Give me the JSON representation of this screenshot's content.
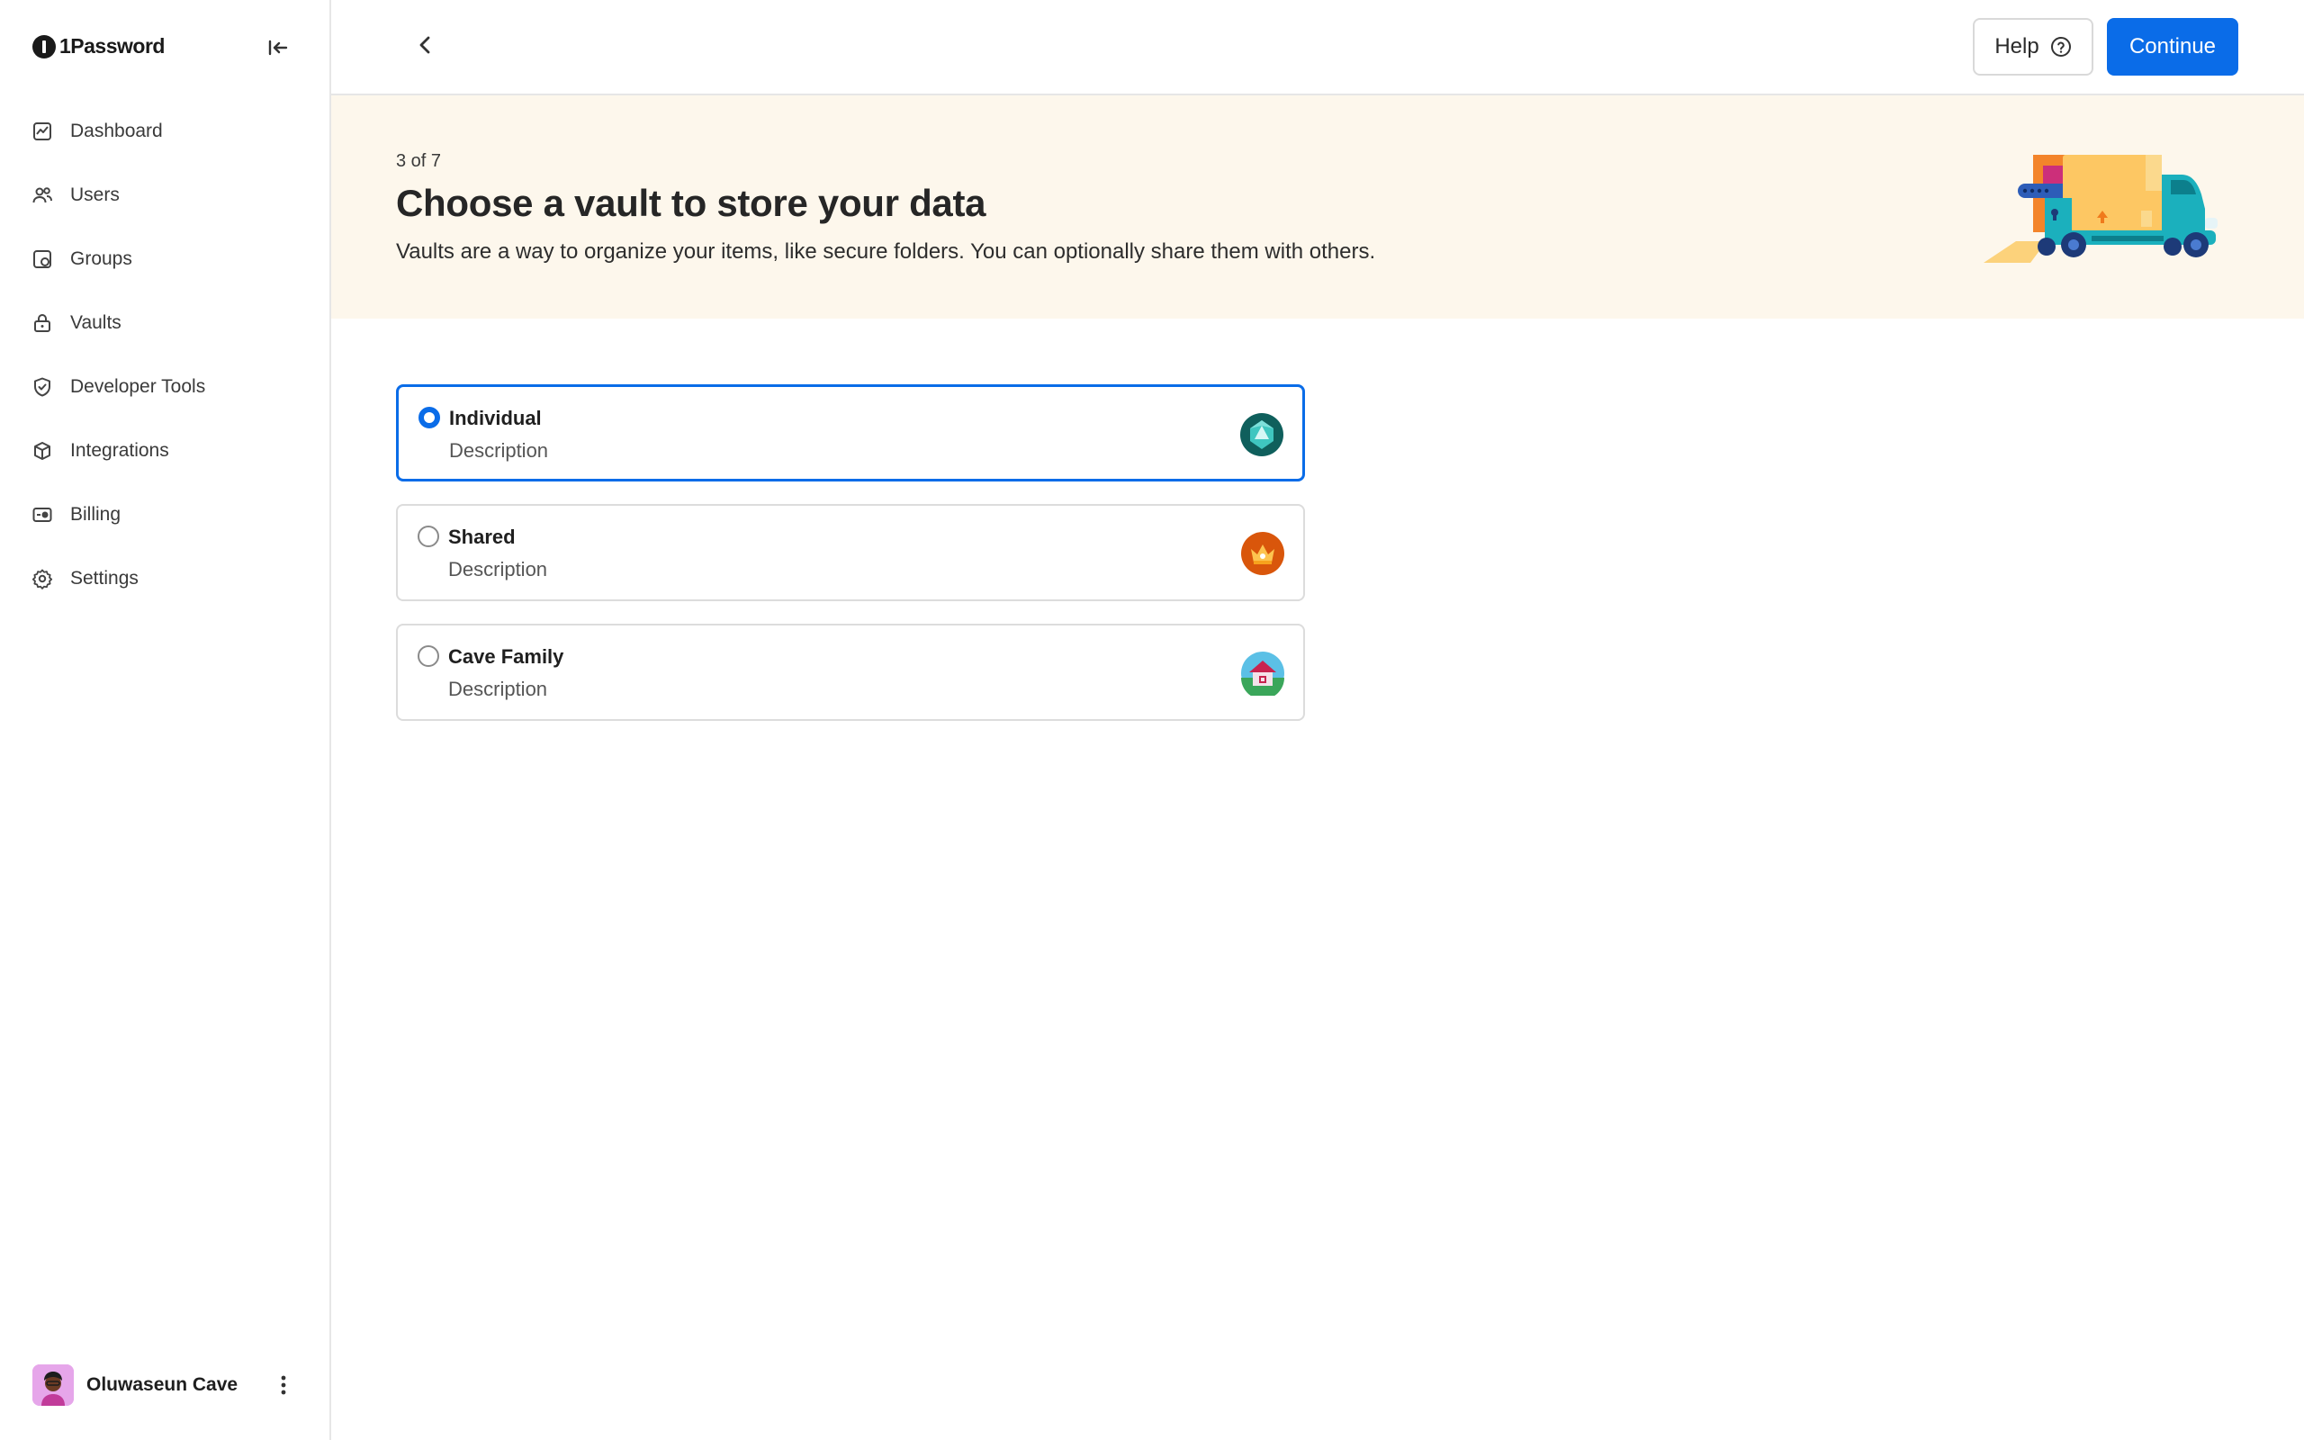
{
  "brand": {
    "name": "1Password"
  },
  "sidebar": {
    "items": [
      {
        "label": "Dashboard",
        "icon": "dashboard-icon"
      },
      {
        "label": "Users",
        "icon": "users-icon"
      },
      {
        "label": "Groups",
        "icon": "groups-icon"
      },
      {
        "label": "Vaults",
        "icon": "lock-icon"
      },
      {
        "label": "Developer Tools",
        "icon": "shield-icon"
      },
      {
        "label": "Integrations",
        "icon": "box-icon"
      },
      {
        "label": "Billing",
        "icon": "billing-icon"
      },
      {
        "label": "Settings",
        "icon": "gear-icon"
      }
    ],
    "user": {
      "name": "Oluwaseun Cave"
    }
  },
  "topbar": {
    "help_label": "Help",
    "continue_label": "Continue"
  },
  "banner": {
    "step": "3 of 7",
    "title": "Choose a vault to store your data",
    "subtitle": "Vaults are a way to organize your items, like secure folders. You can optionally share them with others."
  },
  "vaults": [
    {
      "name": "Individual",
      "description": "Description",
      "selected": true,
      "icon": "gem-icon",
      "color": "#0f5f5c"
    },
    {
      "name": "Shared",
      "description": "Description",
      "selected": false,
      "icon": "crown-icon",
      "color": "#d9560b"
    },
    {
      "name": "Cave Family",
      "description": "Description",
      "selected": false,
      "icon": "house-icon",
      "color": "#5bc0e6"
    }
  ],
  "colors": {
    "accent": "#0a6ce8",
    "banner_bg": "#fdf7ec"
  }
}
